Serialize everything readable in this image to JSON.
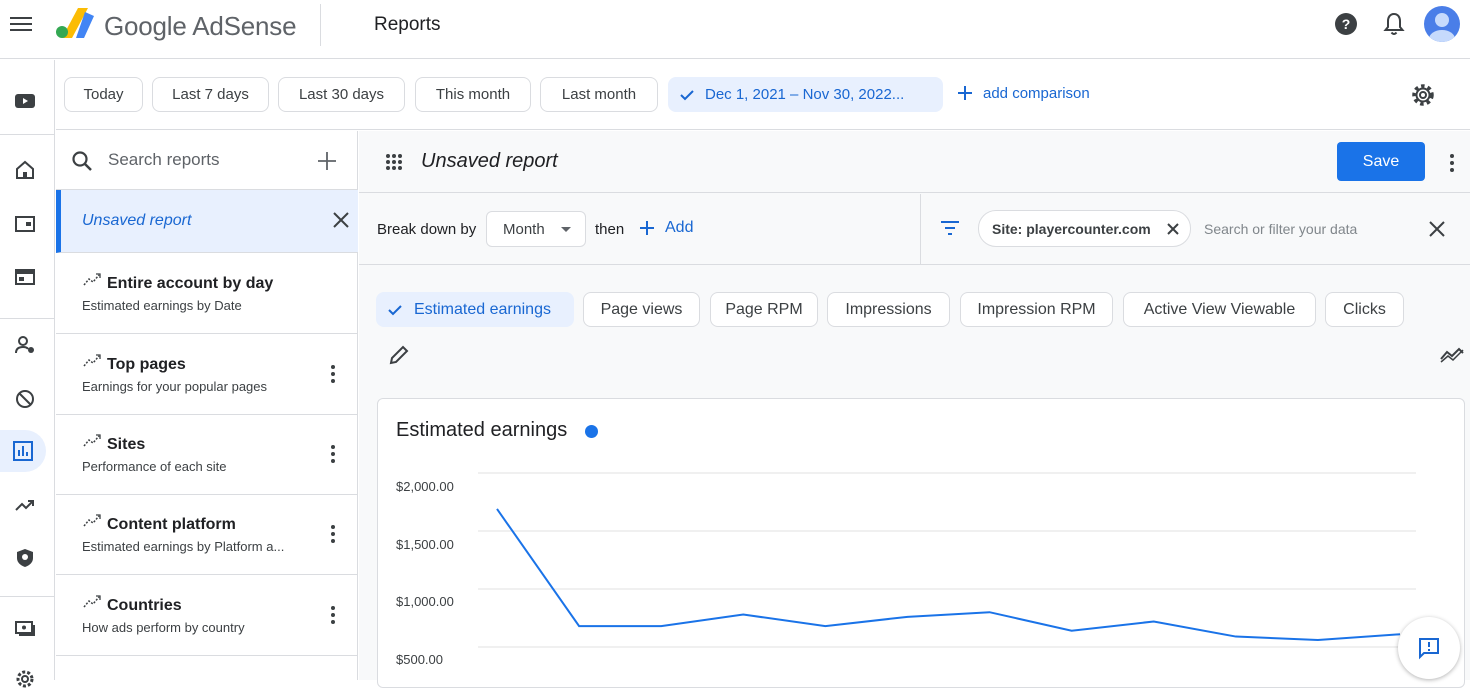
{
  "header": {
    "brand_google": "Google",
    "brand_product": "AdSense",
    "page_title": "Reports"
  },
  "date_filters": {
    "presets": [
      "Today",
      "Last 7 days",
      "Last 30 days",
      "This month",
      "Last month"
    ],
    "selected_range": "Dec 1, 2021 – Nov 30, 2022...",
    "add_comparison": "add comparison"
  },
  "reports_panel": {
    "search_placeholder": "Search reports",
    "current": "Unsaved report",
    "items": [
      {
        "title": "Entire account by day",
        "subtitle": "Estimated earnings by Date"
      },
      {
        "title": "Top pages",
        "subtitle": "Earnings for your popular pages"
      },
      {
        "title": "Sites",
        "subtitle": "Performance of each site"
      },
      {
        "title": "Content platform",
        "subtitle": "Estimated earnings by Platform a..."
      },
      {
        "title": "Countries",
        "subtitle": "How ads perform by country"
      }
    ]
  },
  "report": {
    "name": "Unsaved report",
    "save_label": "Save",
    "breakdown_label": "Break down by",
    "breakdown_value": "Month",
    "then_label": "then",
    "add_label": "Add",
    "filter_chip": "Site: playercounter.com",
    "filter_placeholder": "Search or filter your data",
    "metrics": [
      "Estimated earnings",
      "Page views",
      "Page RPM",
      "Impressions",
      "Impression RPM",
      "Active View Viewable",
      "Clicks"
    ]
  },
  "chart_data": {
    "type": "line",
    "title": "Estimated earnings",
    "color": "#1a73e8",
    "y_ticks": [
      "$2,000.00",
      "$1,500.00",
      "$1,000.00",
      "$500.00"
    ],
    "ylim": [
      500,
      2000
    ],
    "series": [
      {
        "values": [
          1690,
          680,
          680,
          780,
          680,
          760,
          800,
          640,
          720,
          590,
          560,
          610
        ]
      }
    ]
  }
}
